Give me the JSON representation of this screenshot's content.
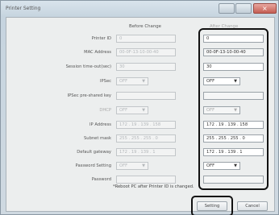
{
  "window": {
    "title": "Printer Setting"
  },
  "headers": {
    "before": "Before Change",
    "after": "After Change"
  },
  "rows": [
    {
      "label": "Printer ID",
      "before": "0",
      "after": "0"
    },
    {
      "label": "MAC Address",
      "before": "00-0F-13-10-00-40",
      "after": "00-0F-13-10-00-40"
    },
    {
      "label": "Session time-out(sec)",
      "before": "30",
      "after": "30"
    },
    {
      "label": "IPSec",
      "before": "OFF",
      "after": "OFF"
    },
    {
      "label": "IPSec pre-shared key",
      "before": "",
      "after": ""
    },
    {
      "label": "DHCP",
      "before": "OFF",
      "after": "OFF"
    },
    {
      "label": "IP Address",
      "before": "172 . 19 . 139 . 158",
      "after": "172 . 19 . 139 . 158"
    },
    {
      "label": "Subnet mask",
      "before": "255 . 255 . 255 . 0",
      "after": "255 . 255 . 255 . 0"
    },
    {
      "label": "Default gateway",
      "before": "172 . 19 . 139 . 1",
      "after": "172 . 19 . 139 . 1"
    },
    {
      "label": "Password Setting",
      "before": "OFF",
      "after": "OFF"
    },
    {
      "label": "Password",
      "before": "",
      "after": ""
    }
  ],
  "note": "*Reboot PC after Printer ID is changed.",
  "buttons": {
    "setting": "Setting",
    "cancel": "Cancel"
  }
}
